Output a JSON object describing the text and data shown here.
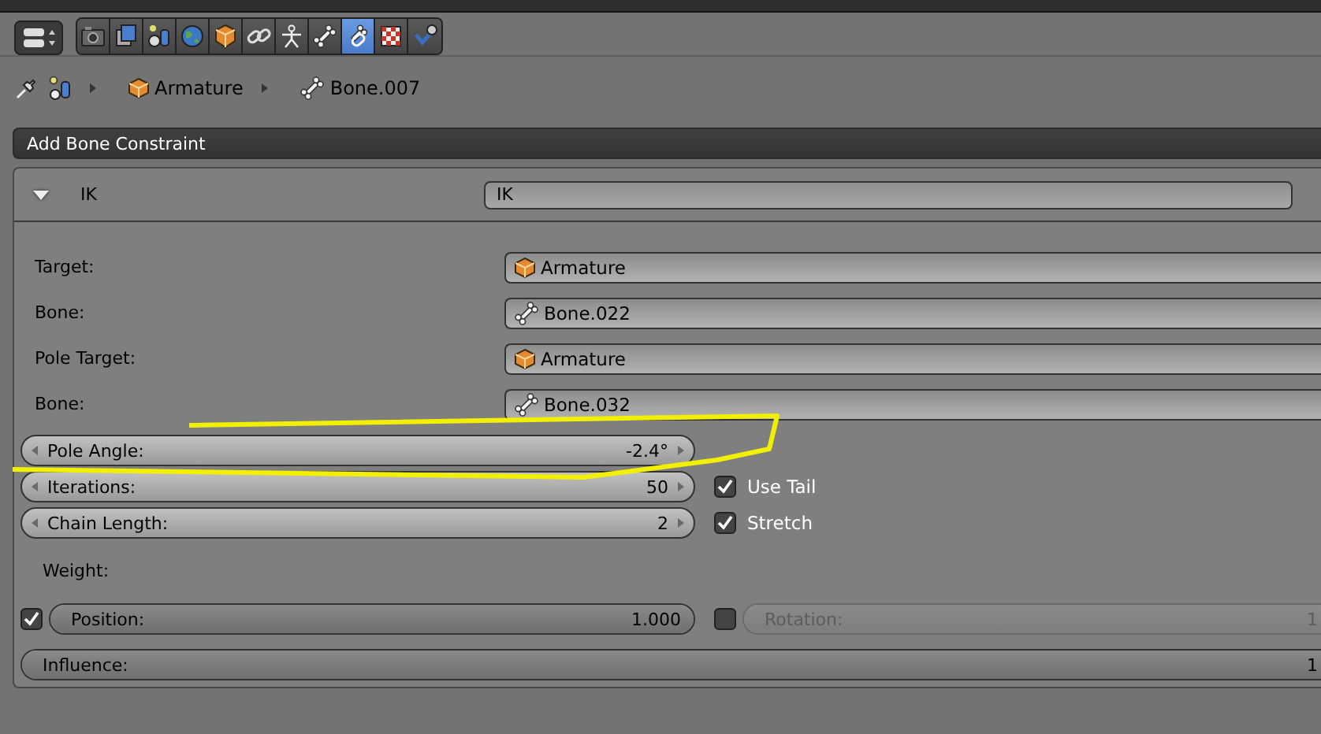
{
  "context_tabs": [
    {
      "kind": "render",
      "selected": false
    },
    {
      "kind": "layers",
      "selected": false
    },
    {
      "kind": "scene",
      "selected": false
    },
    {
      "kind": "world",
      "selected": false
    },
    {
      "kind": "object",
      "selected": false
    },
    {
      "kind": "constraint",
      "selected": false
    },
    {
      "kind": "armature",
      "selected": false
    },
    {
      "kind": "bone",
      "selected": false
    },
    {
      "kind": "bone_constraint",
      "selected": true
    },
    {
      "kind": "texture",
      "selected": false
    },
    {
      "kind": "modifier",
      "selected": false
    }
  ],
  "breadcrumb": [
    {
      "kind": "object",
      "label": "Armature"
    },
    {
      "kind": "bone",
      "label": "Bone.007"
    }
  ],
  "add_constraint_menu": {
    "label": "Add Bone Constraint"
  },
  "constraint": {
    "expanded": true,
    "type_label": "IK",
    "name": "IK",
    "targets": [
      {
        "label": "Target:",
        "kind": "object",
        "value": "Armature"
      },
      {
        "label": "Bone:",
        "kind": "bone",
        "value": "Bone.022"
      },
      {
        "label": "Pole Target:",
        "kind": "object",
        "value": "Armature"
      },
      {
        "label": "Bone:",
        "kind": "bone",
        "value": "Bone.032"
      }
    ],
    "pole_angle": {
      "label": "Pole Angle:",
      "value": "-2.4°"
    },
    "numbers": [
      {
        "label": "Iterations:",
        "value": "50"
      },
      {
        "label": "Chain Length:",
        "value": "2"
      }
    ],
    "options": [
      {
        "label": "Use Tail",
        "checked": true
      },
      {
        "label": "Stretch",
        "checked": true
      }
    ],
    "weight_label": "Weight:",
    "weights": [
      {
        "label": "Position:",
        "value": "1.000",
        "checked": true,
        "level": 1
      },
      {
        "label": "Rotation:",
        "value": "1",
        "checked": false,
        "level": 1
      }
    ],
    "influence": {
      "label": "Influence:",
      "value": "1",
      "level": 1
    }
  }
}
